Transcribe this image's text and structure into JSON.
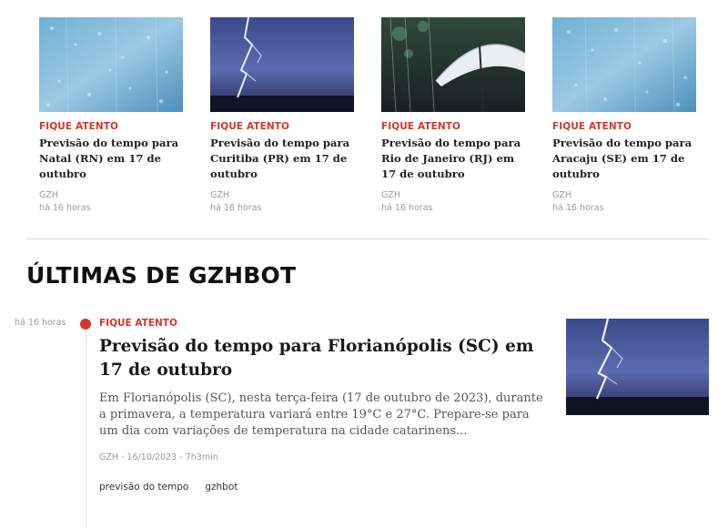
{
  "cards": [
    {
      "kicker": "FIQUE ATENTO",
      "title": "Previsão do tempo para Natal (RN) em 17 de outubro",
      "source": "GZH",
      "age": "há 16 horas",
      "image": "rain-drops-on-glass"
    },
    {
      "kicker": "FIQUE ATENTO",
      "title": "Previsão do tempo para Curitiba (PR) em 17 de outubro",
      "source": "GZH",
      "age": "há 16 horas",
      "image": "lightning-storm"
    },
    {
      "kicker": "FIQUE ATENTO",
      "title": "Previsão do tempo para Rio de Janeiro (RJ) em 17 de outubro",
      "source": "GZH",
      "age": "há 16 horas",
      "image": "umbrella-in-rain"
    },
    {
      "kicker": "FIQUE ATENTO",
      "title": "Previsão do tempo para Aracaju (SE) em 17 de outubro",
      "source": "GZH",
      "age": "há 16 horas",
      "image": "rain-drops-on-glass"
    }
  ],
  "section": {
    "title": "ÚLTIMAS DE GZHBOT"
  },
  "latest": {
    "time": "há 16 horas",
    "kicker": "FIQUE ATENTO",
    "title": "Previsão do tempo para Florianópolis (SC) em 17 de outubro",
    "summary": "Em Florianópolis (SC), nesta terça-feira (17 de outubro de 2023), durante a primavera, a temperatura variará entre 19°C e 27°C. Prepare-se para um dia com variações de temperatura na cidade catarinens...",
    "meta": "GZH - 16/10/2023 - 7h3min",
    "tags": [
      "previsão do tempo",
      "gzhbot"
    ],
    "image": "lightning-storm"
  },
  "colors": {
    "accent": "#d6352d",
    "muted": "#9a9a9a",
    "divider": "#d6d6d6"
  }
}
